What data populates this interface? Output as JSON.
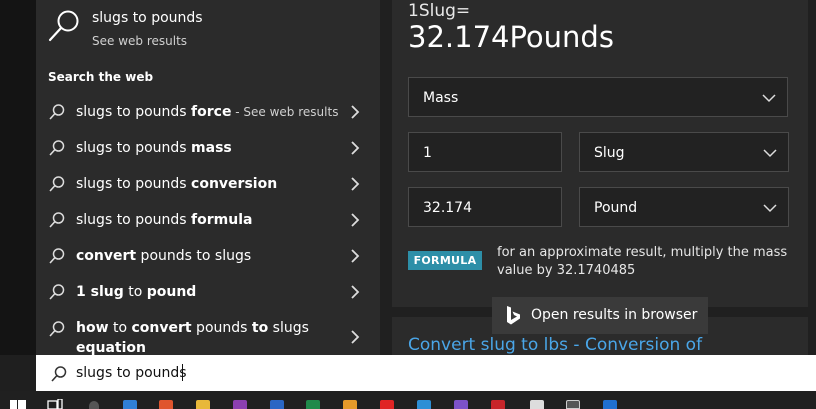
{
  "top_result": {
    "title": "slugs to pounds",
    "subtitle": "See web results"
  },
  "section_heading": "Search the web",
  "suggestions": [
    {
      "pre": "slugs to pounds ",
      "bold": "force",
      "sub": " - See web results"
    },
    {
      "pre": "slugs to pounds ",
      "bold": "mass"
    },
    {
      "pre": "slugs to pounds ",
      "bold": "conversion"
    },
    {
      "pre": "slugs to pounds ",
      "bold": "formula"
    },
    {
      "bold1": "convert",
      "post": " pounds to slugs"
    },
    {
      "bold1": "1 slug",
      "mid": " to ",
      "bold2": "pound"
    },
    {
      "line1_b1": "how",
      "line1_m1": " to ",
      "line1_b2": "convert",
      "line1_m2": " pounds ",
      "line1_b3": "to",
      "line1_m3": " slugs",
      "line2": "equation"
    }
  ],
  "converter": {
    "label": "1Slug=",
    "value": "32.174Pounds",
    "category": "Mass",
    "input_value": "1",
    "from_unit": "Slug",
    "output_value": "32.174",
    "to_unit": "Pound"
  },
  "formula": {
    "badge": "FORMULA",
    "text": "for an approximate result, multiply the mass value by 32.1740485"
  },
  "open_browser": "Open results in browser",
  "result_link": "Convert slug to lbs - Conversion of",
  "search": {
    "value": "slugs to pounds"
  },
  "colors": {
    "accent": "#2d8fa8",
    "link": "#4aa6e8",
    "panel": "#2b2b2b"
  },
  "taskbar_icons": [
    "windows-start",
    "task-view",
    "cortana",
    "edge",
    "brave",
    "file-explorer",
    "onenote",
    "word",
    "excel",
    "chrome-canary",
    "youtube",
    "vscode",
    "obsidian",
    "zotero",
    "app",
    "terminal",
    "edge-dev"
  ]
}
